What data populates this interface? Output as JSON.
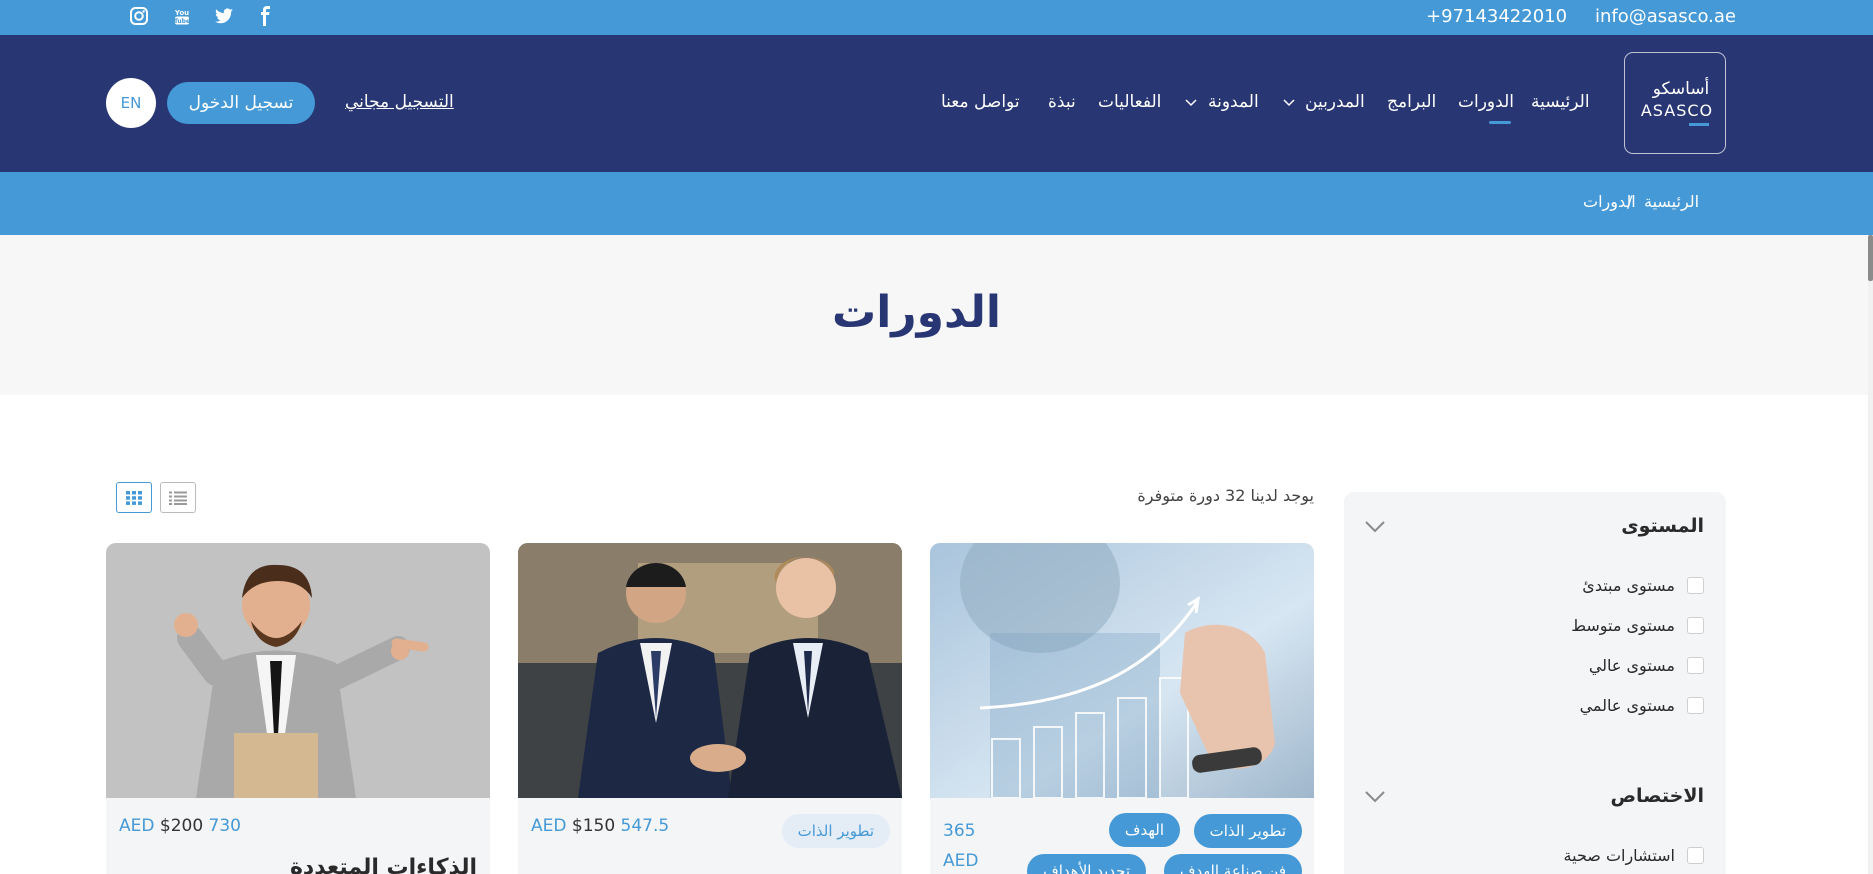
{
  "topbar": {
    "email": "info@asasco.ae",
    "phone": "+97143422010",
    "social_icons": [
      "facebook-icon",
      "twitter-icon",
      "youtube-icon",
      "instagram-icon"
    ]
  },
  "logo": {
    "arabic": "أساسكو",
    "english": "ASASCO"
  },
  "nav": {
    "items": [
      {
        "label": "الرئيسية"
      },
      {
        "label": "الدورات",
        "active": true
      },
      {
        "label": "البرامج"
      },
      {
        "label": "المدربين",
        "dropdown": true
      },
      {
        "label": "المدونة",
        "dropdown": true
      },
      {
        "label": "الفعاليات"
      },
      {
        "label": "نبذة"
      },
      {
        "label": "تواصل معنا"
      }
    ],
    "signup_link": "التسجيل مجاني",
    "login_button": "تسجيل الدخول",
    "language_button": "EN"
  },
  "breadcrumb": {
    "home": "الرئيسية",
    "separator": "/",
    "current": "الدورات"
  },
  "page_title": "الدورات",
  "results": {
    "count_text": "يوجد لدينا 32 دورة متوفرة"
  },
  "filters": [
    {
      "title": "المستوى",
      "options": [
        "مستوى مبتدئ",
        "مستوى متوسط",
        "مستوى عالي",
        "مستوى عالمي"
      ]
    },
    {
      "title": "الاختصاص",
      "options": [
        "استشارات صحية"
      ]
    }
  ],
  "courses": [
    {
      "image": "growth-chart-hand-photo",
      "price_new": "365",
      "currency": "AED",
      "tags": [
        "تطوير الذات",
        "الهدف",
        "فن صناعة الهدف",
        "تحديد الأهداف"
      ]
    },
    {
      "image": "business-handshake-photo",
      "price_new": "547.5",
      "price_old": "$150",
      "currency": "AED",
      "tags": [
        "تطوير الذات"
      ]
    },
    {
      "image": "businessman-ok-gesture-photo",
      "price_new": "730",
      "price_old": "$200",
      "currency": "AED",
      "title": "الذكاءات المتعددة"
    }
  ],
  "colors": {
    "accent": "#4499d6",
    "navy": "#283673",
    "panel": "#f4f5f7"
  }
}
